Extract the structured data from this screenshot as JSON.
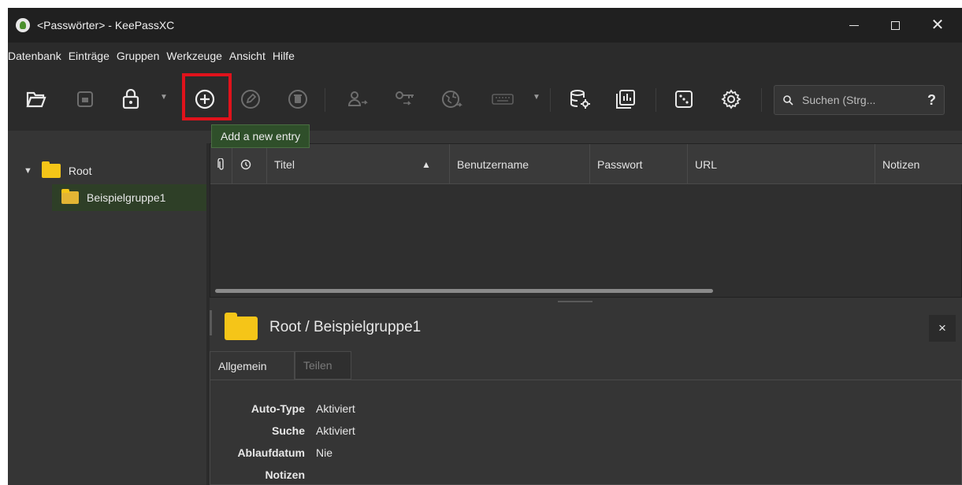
{
  "window": {
    "title": "<Passwörter> - KeePassXC"
  },
  "menu": [
    "Datenbank",
    "Einträge",
    "Gruppen",
    "Werkzeuge",
    "Ansicht",
    "Hilfe"
  ],
  "search": {
    "placeholder": "Suchen (Strg...",
    "help": "?"
  },
  "tooltip": "Add a new entry",
  "tree": {
    "root": "Root",
    "child": "Beispielgruppe1"
  },
  "table": {
    "columns": [
      "Titel",
      "Benutzername",
      "Passwort",
      "URL",
      "Notizen"
    ],
    "sort_indicator": "▲"
  },
  "details": {
    "title": "Root / Beispielgruppe1",
    "close": "×",
    "tabs": [
      "Allgemein",
      "Teilen"
    ],
    "fields": [
      {
        "label": "Auto-Type",
        "value": "Aktiviert"
      },
      {
        "label": "Suche",
        "value": "Aktiviert"
      },
      {
        "label": "Ablaufdatum",
        "value": "Nie"
      },
      {
        "label": "Notizen",
        "value": ""
      }
    ]
  },
  "colors": {
    "highlight": "#e0121b",
    "tooltip_bg": "#2f4f2a",
    "folder": "#f5c518",
    "selection": "#2e3f27"
  }
}
